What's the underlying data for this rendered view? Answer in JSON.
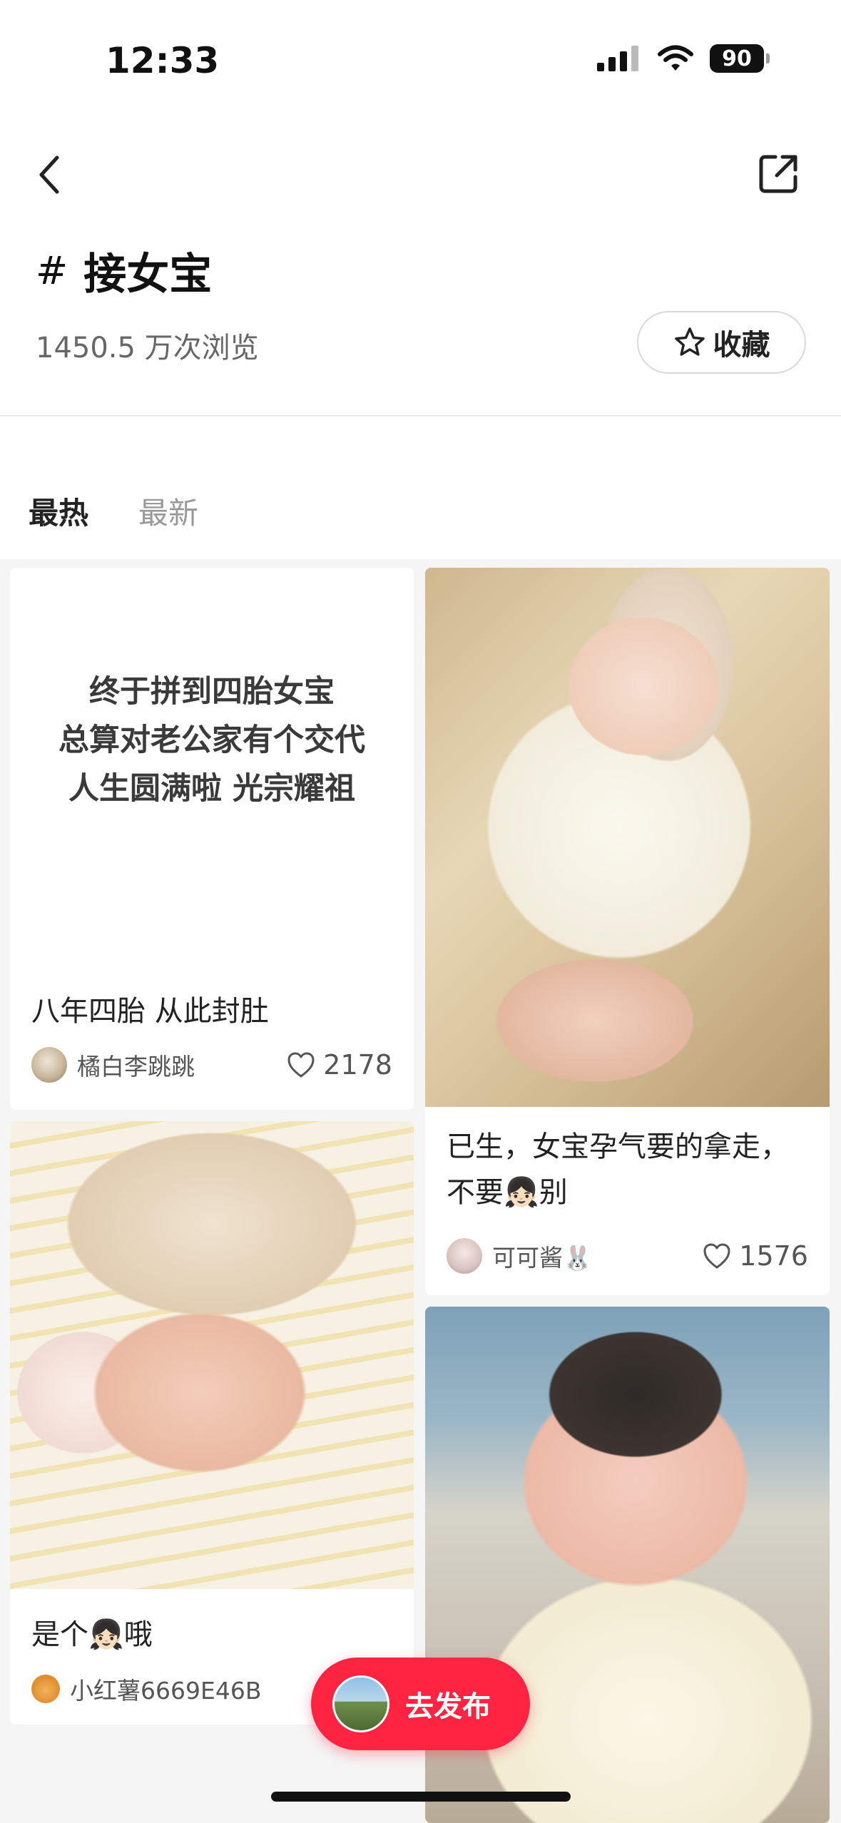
{
  "status_bar": {
    "time": "12:33",
    "battery": "90"
  },
  "topic": {
    "title": "接女宝",
    "views": "1450.5 万次浏览",
    "favorite_label": "收藏"
  },
  "tabs": [
    {
      "label": "最热"
    },
    {
      "label": "最新"
    }
  ],
  "posts": [
    {
      "cover_text": [
        "终于拼到四胎女宝",
        "总算对老公家有个交代",
        "人生圆满啦 光宗耀祖"
      ],
      "title": "八年四胎 从此封肚",
      "author": "橘白李跳跳",
      "likes": "2178"
    },
    {
      "title": "已生，女宝孕气要的拿走，不要👧🏻别",
      "author": "可可酱🐰",
      "likes": "1576"
    },
    {
      "title": "是个👧🏻哦",
      "author": "小红薯6669E46B",
      "likes": ""
    }
  ],
  "publish_button": {
    "label": "去发布"
  },
  "colors": {
    "accent": "#ff2442",
    "background": "#f5f5f5"
  },
  "icons": [
    "back-icon",
    "share-icon",
    "hash-icon",
    "star-icon",
    "heart-icon",
    "signal-icon",
    "wifi-icon",
    "battery-icon"
  ]
}
